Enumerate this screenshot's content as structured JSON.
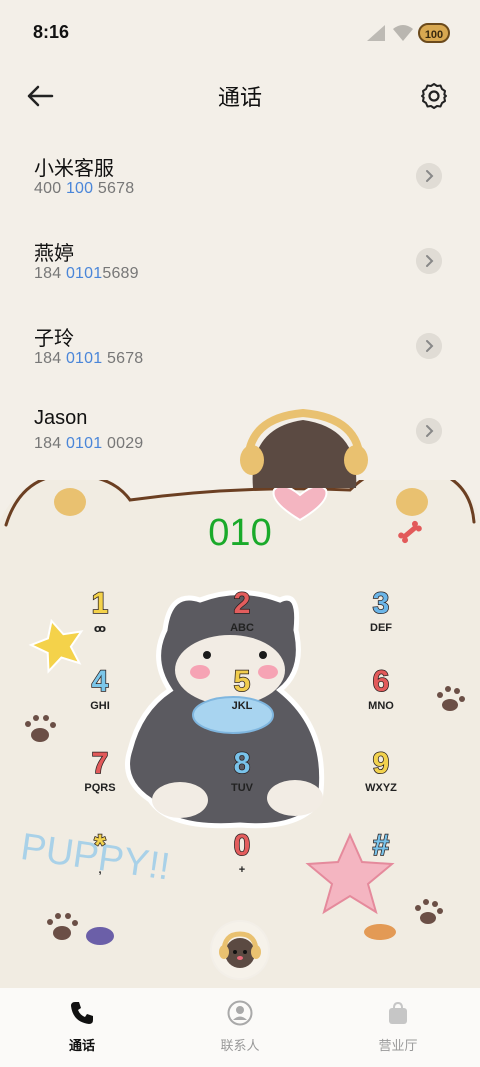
{
  "status_bar": {
    "time": "8:16",
    "battery": "100"
  },
  "header": {
    "title": "通话"
  },
  "contacts": [
    {
      "name": "小米客服",
      "num_a": "400 ",
      "num_b": "100",
      "num_c": " 5678"
    },
    {
      "name": "燕婷",
      "num_a": "184 ",
      "num_b": "0101",
      "num_c": "5689"
    },
    {
      "name": "子玲",
      "num_a": "184 ",
      "num_b": "0101",
      "num_c": " 5678"
    },
    {
      "name": "Jason",
      "num_a": "184 ",
      "num_b": "0101",
      "num_c": " 0029"
    }
  ],
  "dialer": {
    "display": "010",
    "keys": [
      {
        "digit": "1",
        "letters": "ꝏ",
        "color": "#f4d24a"
      },
      {
        "digit": "2",
        "letters": "ABC",
        "color": "#e35d5d"
      },
      {
        "digit": "3",
        "letters": "DEF",
        "color": "#6cb6e8"
      },
      {
        "digit": "4",
        "letters": "GHI",
        "color": "#7cc7ea"
      },
      {
        "digit": "5",
        "letters": "JKL",
        "color": "#f1cd4e"
      },
      {
        "digit": "6",
        "letters": "MNO",
        "color": "#e25a5a"
      },
      {
        "digit": "7",
        "letters": "PQRS",
        "color": "#e25a5a"
      },
      {
        "digit": "8",
        "letters": "TUV",
        "color": "#79c3ea"
      },
      {
        "digit": "9",
        "letters": "WXYZ",
        "color": "#f2d24e"
      },
      {
        "digit": "*",
        "letters": ",",
        "color": "#f2d24e"
      },
      {
        "digit": "0",
        "letters": "+",
        "color": "#e35d5d"
      },
      {
        "digit": "#",
        "letters": "",
        "color": "#79c3ea"
      }
    ]
  },
  "bottom_nav": [
    {
      "label": "通话"
    },
    {
      "label": "联系人"
    },
    {
      "label": "营业厅"
    }
  ]
}
